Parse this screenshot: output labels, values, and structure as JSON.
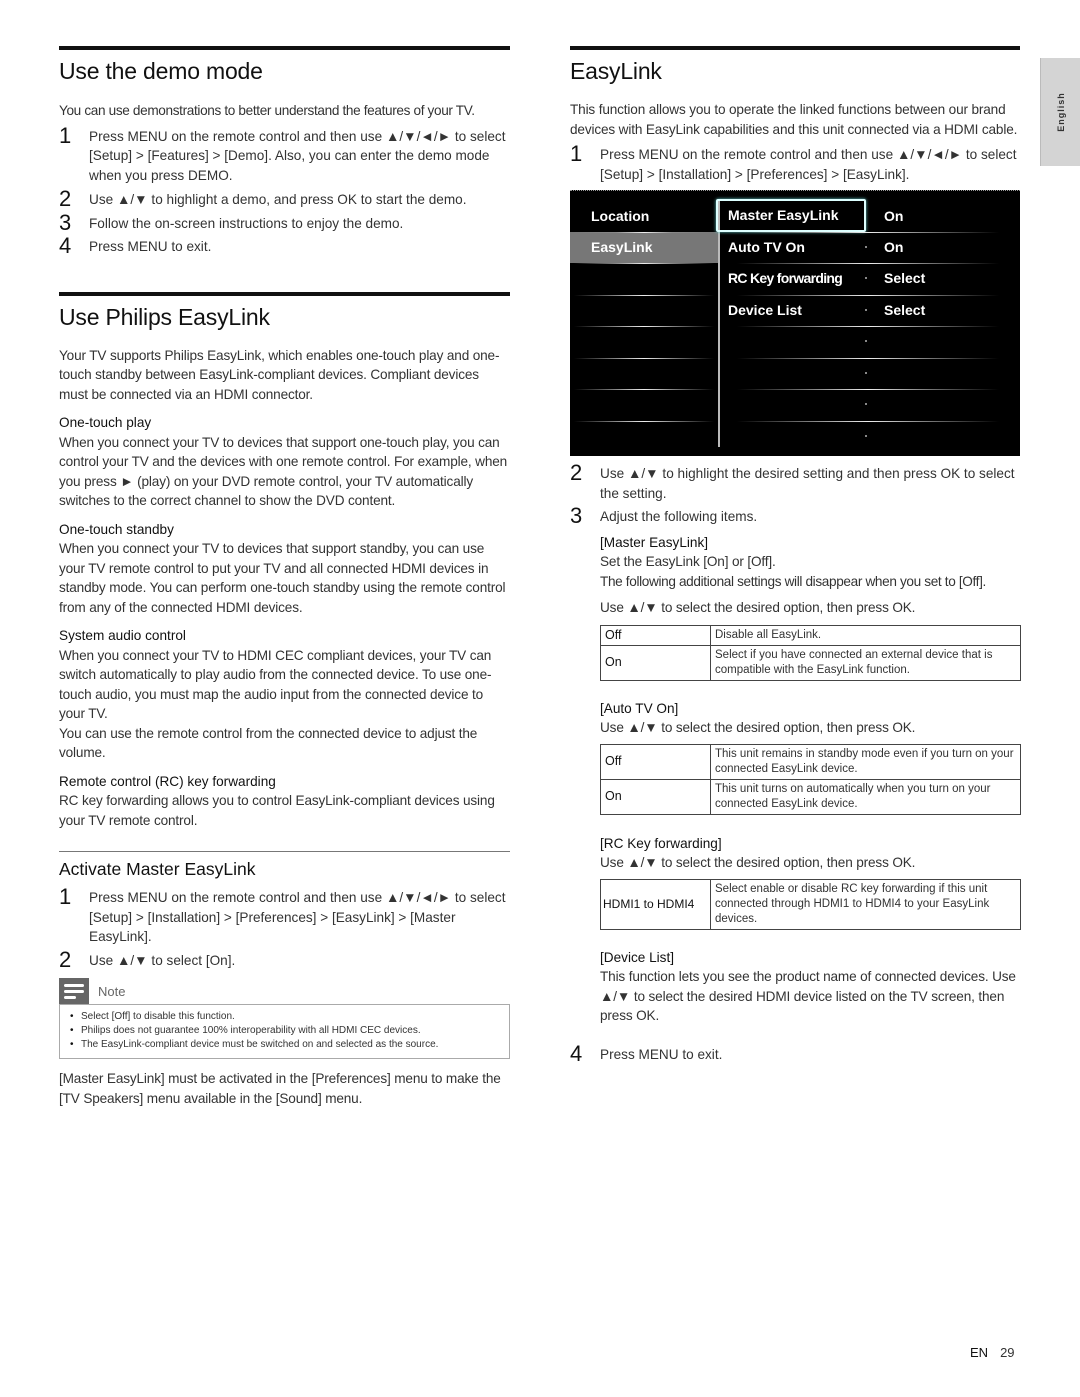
{
  "side_tab": {
    "label": "English"
  },
  "footer": {
    "lang": "EN",
    "page": "29"
  },
  "demo": {
    "title": "Use the demo mode",
    "intro": "You can use demonstrations to better understand the features of your TV.",
    "steps": [
      {
        "num": "1",
        "text": "Press MENU on the remote control and then use ▲/▼/◄/► to select [Setup] > [Features] > [Demo]. Also, you can enter the demo mode when you press DEMO."
      },
      {
        "num": "2",
        "text": "Use ▲/▼ to highlight a demo, and press OK to start the demo."
      },
      {
        "num": "3",
        "text": "Follow the on-screen instructions to enjoy the demo."
      },
      {
        "num": "4",
        "text": "Press MENU to exit."
      }
    ]
  },
  "philips_easylink": {
    "title": "Use Philips EasyLink",
    "intro": "Your TV supports Philips EasyLink, which enables one-touch play and one-touch standby between EasyLink-compliant devices. Compliant devices must be connected via an HDMI connector.",
    "features": [
      {
        "heading": "One-touch play",
        "text": "When you connect your TV to devices that support one-touch play, you can control your TV and the devices with one remote control. For example, when you press ► (play) on your DVD remote control, your TV automatically switches to the correct channel to show the DVD content."
      },
      {
        "heading": "One-touch standby",
        "text": "When you connect your TV to devices that support standby, you can use your TV remote control to put your TV and all connected HDMI devices in standby mode. You can perform one-touch standby using the remote control from any of the connected HDMI devices."
      },
      {
        "heading": "System audio control",
        "text": "When you connect your TV to HDMI CEC compliant devices, your TV can switch automatically to play audio from the connected device. To use one-touch audio, you must map the audio input from the connected device to your TV.",
        "text2": "You can use the remote control from the connected device to adjust the volume."
      },
      {
        "heading": "Remote control (RC) key forwarding",
        "text": "RC key forwarding allows you to control EasyLink-compliant devices using your TV remote control."
      }
    ]
  },
  "activate": {
    "title": "Activate Master EasyLink",
    "steps": [
      {
        "num": "1",
        "text": "Press MENU on the remote control and then use ▲/▼/◄/► to select [Setup] > [Installation] > [Preferences] > [EasyLink] > [Master EasyLink]."
      },
      {
        "num": "2",
        "text": "Use ▲/▼ to select [On]."
      }
    ],
    "note": {
      "label": "Note",
      "items": [
        "Select [Off] to disable this function.",
        "Philips does not guarantee 100% interoperability with all HDMI CEC devices.",
        "The EasyLink-compliant device must be switched on and selected as the source."
      ]
    },
    "outro": "[Master EasyLink] must be activated in the [Preferences] menu to make the [TV Speakers] menu available in the [Sound] menu."
  },
  "easylink": {
    "title": "EasyLink",
    "intro": "This function allows you to operate the linked functions between our brand devices with EasyLink capabilities and this unit connected via a HDMI cable.",
    "step1": {
      "num": "1",
      "text": "Press MENU on the remote control and then use ▲/▼/◄/► to select [Setup] > [Installation] > [Preferences] > [EasyLink]."
    },
    "osd": {
      "left_items": [
        {
          "label": "Location",
          "selected": false
        },
        {
          "label": "EasyLink",
          "selected": true
        }
      ],
      "right_items": [
        {
          "label": "Master EasyLink",
          "value": "On",
          "focused": true
        },
        {
          "label": "Auto TV On",
          "value": "On",
          "focused": false
        },
        {
          "label": "RC Key forwarding",
          "value": "Select",
          "focused": false
        },
        {
          "label": "Device List",
          "value": "Select",
          "focused": false
        }
      ]
    },
    "step2": {
      "num": "2",
      "text": "Use ▲/▼ to highlight the desired setting and then press OK to select the setting."
    },
    "step3": {
      "num": "3",
      "text": "Adjust the following items."
    },
    "master": {
      "heading": "[Master EasyLink]",
      "line1": "Set the EasyLink [On] or [Off].",
      "line2": "The following additional settings will disappear when you set to [Off].",
      "instr": "Use ▲/▼ to select the desired option, then press OK.",
      "options": [
        {
          "key": "Off",
          "desc": "Disable all EasyLink."
        },
        {
          "key": "On",
          "desc": "Select if you have connected an external device that is compatible with the EasyLink function."
        }
      ]
    },
    "auto_tv": {
      "heading": "[Auto TV On]",
      "instr": "Use ▲/▼ to select the desired option, then press OK.",
      "options": [
        {
          "key": "Off",
          "desc": "This unit remains in standby mode even if you turn on your connected EasyLink device."
        },
        {
          "key": "On",
          "desc": "This unit turns on automatically when you turn on your connected EasyLink device."
        }
      ]
    },
    "rc_key": {
      "heading": "[RC Key forwarding]",
      "instr": "Use ▲/▼ to select the desired option, then press OK.",
      "options": [
        {
          "key": "HDMI1 to HDMI4",
          "desc": "Select enable or disable RC key forwarding if this unit connected through HDMI1 to HDMI4 to your EasyLink devices."
        }
      ]
    },
    "device_list": {
      "heading": "[Device List]",
      "text": "This function lets you see the product name of connected devices. Use ▲/▼ to select the desired HDMI device listed on the TV screen, then press OK."
    },
    "step4": {
      "num": "4",
      "text": "Press MENU to exit."
    }
  }
}
